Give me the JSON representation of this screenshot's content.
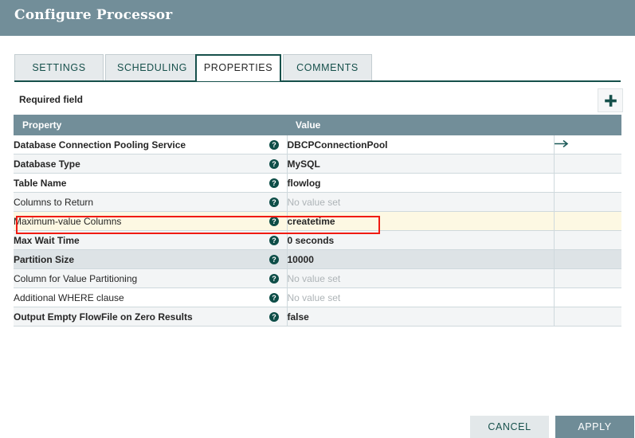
{
  "dialog": {
    "title": "Configure Processor"
  },
  "tabs": [
    {
      "label": "SETTINGS",
      "active": false
    },
    {
      "label": "SCHEDULING",
      "active": false
    },
    {
      "label": "PROPERTIES",
      "active": true
    },
    {
      "label": "COMMENTS",
      "active": false
    }
  ],
  "toolbar": {
    "required_field_label": "Required field",
    "add_icon": "plus-icon"
  },
  "table": {
    "columns": [
      "Property",
      "Value",
      ""
    ],
    "rows": [
      {
        "property": "Database Connection Pooling Service",
        "required": true,
        "value": "DBCPConnectionPool",
        "value_set": true,
        "help_icon": "help-icon",
        "action_icon": "go-to-arrow-icon",
        "state": "odd"
      },
      {
        "property": "Database Type",
        "required": true,
        "value": "MySQL",
        "value_set": true,
        "help_icon": "help-icon",
        "action_icon": "",
        "state": "even"
      },
      {
        "property": "Table Name",
        "required": true,
        "value": "flowlog",
        "value_set": true,
        "help_icon": "help-icon",
        "action_icon": "",
        "state": "odd"
      },
      {
        "property": "Columns to Return",
        "required": false,
        "value": "No value set",
        "value_set": false,
        "help_icon": "help-icon",
        "action_icon": "",
        "state": "even"
      },
      {
        "property": "Maximum-value Columns",
        "required": false,
        "value": "createtime",
        "value_set": true,
        "help_icon": "help-icon",
        "action_icon": "",
        "state": "highlight"
      },
      {
        "property": "Max Wait Time",
        "required": true,
        "value": "0 seconds",
        "value_set": true,
        "help_icon": "help-icon",
        "action_icon": "",
        "state": "even"
      },
      {
        "property": "Partition Size",
        "required": true,
        "value": "10000",
        "value_set": true,
        "help_icon": "help-icon",
        "action_icon": "",
        "state": "selected"
      },
      {
        "property": "Column for Value Partitioning",
        "required": false,
        "value": "No value set",
        "value_set": false,
        "help_icon": "help-icon",
        "action_icon": "",
        "state": "even"
      },
      {
        "property": "Additional WHERE clause",
        "required": false,
        "value": "No value set",
        "value_set": false,
        "help_icon": "help-icon",
        "action_icon": "",
        "state": "odd"
      },
      {
        "property": "Output Empty FlowFile on Zero Results",
        "required": true,
        "value": "false",
        "value_set": true,
        "help_icon": "help-icon",
        "action_icon": "",
        "state": "even"
      }
    ]
  },
  "footer": {
    "cancel_label": "CANCEL",
    "apply_label": "APPLY"
  },
  "colors": {
    "header_bar": "#728e99",
    "accent_teal": "#16504b",
    "highlight_row": "#fdf8e3",
    "selected_row": "#dde3e6",
    "annotation": "#f01b12",
    "apply_button": "#6f8c97"
  }
}
